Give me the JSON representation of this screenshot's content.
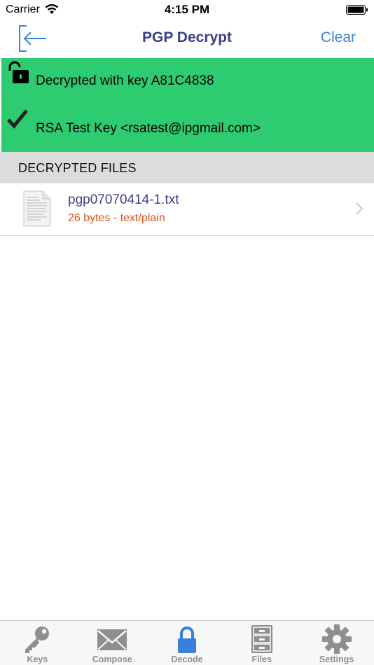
{
  "status_bar": {
    "carrier": "Carrier",
    "time": "4:15 PM"
  },
  "nav": {
    "title": "PGP Decrypt",
    "clear_label": "Clear",
    "back_icon": "back-arrow-icon"
  },
  "decrypt_status": {
    "key_text": "Decrypted with key A81C4838",
    "signer_text": "RSA Test Key <rsatest@ipgmail.com>",
    "panel_color": "#2ecc71"
  },
  "section": {
    "header": "DECRYPTED FILES"
  },
  "files": [
    {
      "name": "pgp07070414-1.txt",
      "meta": "26 bytes - text/plain",
      "icon": "document-icon"
    }
  ],
  "tabs": [
    {
      "label": "Keys",
      "icon": "key-icon",
      "active": false
    },
    {
      "label": "Compose",
      "icon": "envelope-icon",
      "active": false
    },
    {
      "label": "Decode",
      "icon": "lock-icon",
      "active": true
    },
    {
      "label": "Files",
      "icon": "cabinet-icon",
      "active": false
    },
    {
      "label": "Settings",
      "icon": "gear-icon",
      "active": false
    }
  ],
  "colors": {
    "title": "#3b3f8c",
    "accent": "#3a86d8",
    "active_tab": "#3a7ee0",
    "inactive_tab": "#8e8e93",
    "file_meta": "#d9541e"
  }
}
